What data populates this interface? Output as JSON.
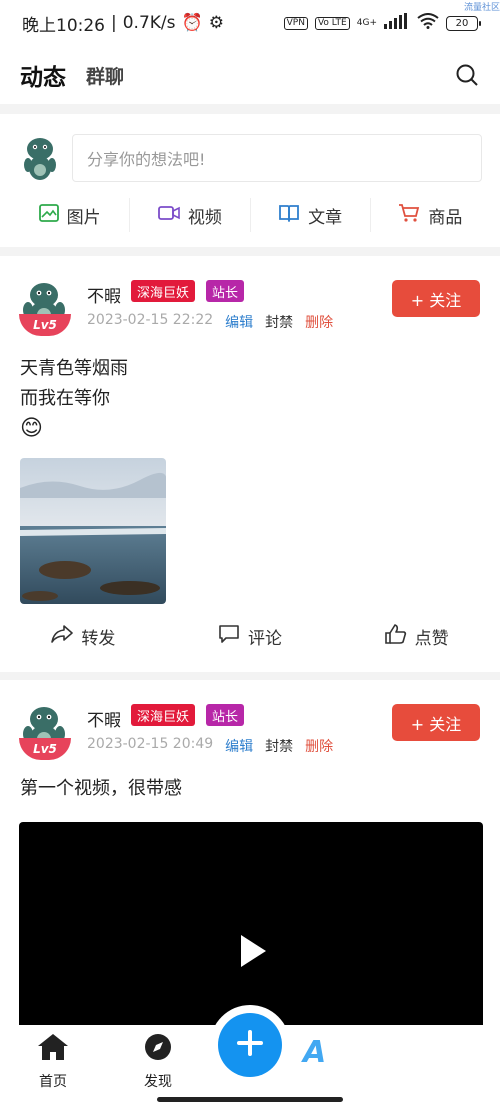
{
  "status_bar": {
    "time": "晚上10:26",
    "network_speed": "0.7K/s",
    "vpn": "VPN",
    "volte": "Vo LTE",
    "signal": "4G+",
    "battery": "20",
    "corner_tag": "流量社区"
  },
  "nav": {
    "tabs": [
      {
        "label": "动态",
        "active": true
      },
      {
        "label": "群聊",
        "active": false
      }
    ]
  },
  "composer": {
    "placeholder": "分享你的想法吧!",
    "actions": [
      {
        "label": "图片",
        "icon": "image-icon",
        "color": "#2eaa4b"
      },
      {
        "label": "视频",
        "icon": "video-icon",
        "color": "#7b4cc9"
      },
      {
        "label": "文章",
        "icon": "book-icon",
        "color": "#2f7fcd"
      },
      {
        "label": "商品",
        "icon": "cart-icon",
        "color": "#e0513f"
      }
    ]
  },
  "posts": [
    {
      "author": "不暇",
      "level": "Lv5",
      "tags": [
        "深海巨妖",
        "站长"
      ],
      "time": "2023-02-15 22:22",
      "edit": "编辑",
      "ban": "封禁",
      "delete": "删除",
      "follow": "+ 关注",
      "lines": [
        "天青色等烟雨",
        "而我在等你"
      ],
      "emoji": "😊",
      "has_image": true,
      "actions": {
        "share": "转发",
        "comment": "评论",
        "like": "点赞"
      }
    },
    {
      "author": "不暇",
      "level": "Lv5",
      "tags": [
        "深海巨妖",
        "站长"
      ],
      "time": "2023-02-15 20:49",
      "edit": "编辑",
      "ban": "封禁",
      "delete": "删除",
      "follow": "+ 关注",
      "lines": [
        "第一个视频，很带感"
      ],
      "has_video": true
    }
  ],
  "bottom_nav": {
    "home": "首页",
    "discover": "发现",
    "partial_glyph": "A"
  }
}
